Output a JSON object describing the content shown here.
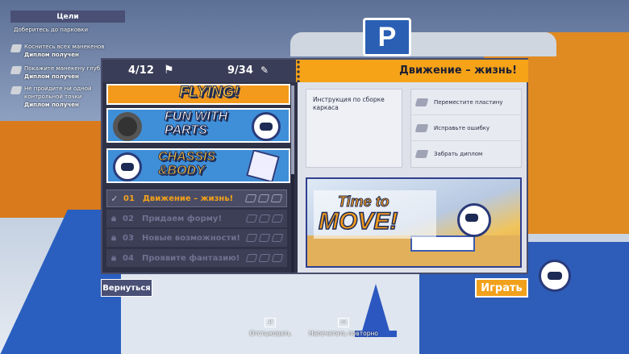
{
  "objectives": {
    "header": "Цели",
    "subtitle": "Доберитесь до парковки",
    "items": [
      {
        "text": "Коснитесь всех манекенов",
        "status": "Диплом получен"
      },
      {
        "text": "Покажите манекену глуб",
        "status": "Диплом получен"
      },
      {
        "text": "Не пройдите ни одной контрольной точки",
        "status": "Диплом получен"
      }
    ]
  },
  "stats": {
    "checkpoints": "4/12",
    "diplomas": "9/34"
  },
  "chapter_title": "Движение – жизнь!",
  "chapters": [
    {
      "label": "FLYING!"
    },
    {
      "label": "FUN WITH PARTS"
    },
    {
      "label": "CHASSIS &BODY"
    }
  ],
  "levels": [
    {
      "num": "01",
      "name": "Движение – жизнь!",
      "state": "completed"
    },
    {
      "num": "02",
      "name": "Придаем форму!",
      "state": "locked"
    },
    {
      "num": "03",
      "name": "Новые возможности!",
      "state": "locked"
    },
    {
      "num": "04",
      "name": "Проявите фантазию!",
      "state": "locked"
    }
  ],
  "instruction": "Инструкция по сборке каркаса",
  "challenges": [
    "Переместите пластину",
    "Исправьте ошибку",
    "Забрать диплом"
  ],
  "preview": {
    "line1": "Time to",
    "line2": "MOVE!"
  },
  "buttons": {
    "back": "Вернуться",
    "play": "Играть"
  },
  "hints": {
    "undock": "Отстыковать",
    "reprint": "Напечатать повторно"
  },
  "colors": {
    "accent": "#f4a21a",
    "panel": "#2f3247",
    "blue": "#2b5fb4"
  }
}
